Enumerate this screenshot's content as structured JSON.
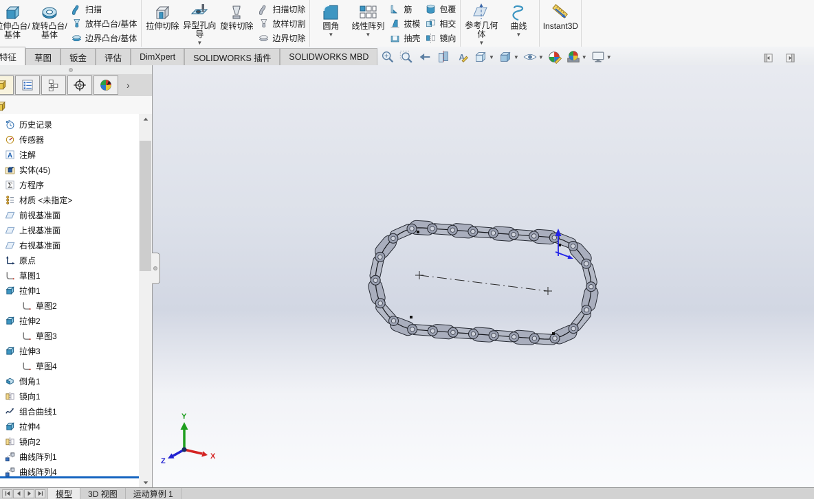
{
  "ribbon": {
    "groups": [
      {
        "name": "boss-base",
        "big": [
          {
            "label": "拉伸凸台/基体",
            "icon": "extrude-boss"
          },
          {
            "label": "旋转凸台/基体",
            "icon": "revolve-boss"
          }
        ],
        "small": [
          {
            "label": "扫描",
            "icon": "sweep"
          },
          {
            "label": "放样凸台/基体",
            "icon": "loft"
          },
          {
            "label": "边界凸台/基体",
            "icon": "boundary"
          }
        ]
      },
      {
        "name": "cut",
        "big": [
          {
            "label": "拉伸切除",
            "icon": "extrude-cut"
          },
          {
            "label": "异型孔向导",
            "icon": "hole-wizard",
            "dropdown": true
          },
          {
            "label": "旋转切除",
            "icon": "revolve-cut"
          }
        ],
        "small": [
          {
            "label": "扫描切除",
            "icon": "sweep-cut"
          },
          {
            "label": "放样切割",
            "icon": "loft-cut"
          },
          {
            "label": "边界切除",
            "icon": "boundary-cut"
          }
        ]
      },
      {
        "name": "pattern-features",
        "big": [
          {
            "label": "圆角",
            "icon": "fillet",
            "dropdown": true
          },
          {
            "label": "线性阵列",
            "icon": "linear-pattern",
            "dropdown": true
          }
        ],
        "small": [
          {
            "label": "筋",
            "icon": "rib"
          },
          {
            "label": "拔模",
            "icon": "draft"
          },
          {
            "label": "抽壳",
            "icon": "shell"
          }
        ],
        "small2": [
          {
            "label": "包覆",
            "icon": "wrap"
          },
          {
            "label": "相交",
            "icon": "intersect"
          },
          {
            "label": "镜向",
            "icon": "mirror-feature"
          }
        ]
      },
      {
        "name": "reference",
        "big": [
          {
            "label": "参考几何体",
            "icon": "reference-geometry",
            "dropdown": true
          },
          {
            "label": "曲线",
            "icon": "curves",
            "dropdown": true
          }
        ]
      },
      {
        "name": "instant3d",
        "big": [
          {
            "label": "Instant3D",
            "icon": "instant3d"
          }
        ]
      }
    ]
  },
  "command_tabs": [
    {
      "label": "特征",
      "active": true
    },
    {
      "label": "草图"
    },
    {
      "label": "钣金"
    },
    {
      "label": "评估"
    },
    {
      "label": "DimXpert"
    },
    {
      "label": "SOLIDWORKS 插件"
    },
    {
      "label": "SOLIDWORKS MBD"
    }
  ],
  "headsup": [
    {
      "name": "zoom-to-fit"
    },
    {
      "name": "zoom-to-area"
    },
    {
      "name": "previous-view"
    },
    {
      "name": "section-view"
    },
    {
      "name": "annotation-visibility"
    },
    {
      "name": "view-orientation",
      "dropdown": true
    },
    {
      "name": "display-style",
      "dropdown": true
    },
    {
      "name": "hide-show-items",
      "dropdown": true
    },
    {
      "name": "edit-appearance"
    },
    {
      "name": "apply-scene",
      "dropdown": true
    },
    {
      "name": "view-settings",
      "dropdown": true
    }
  ],
  "panel_toggles": [
    {
      "name": "collapse-left-pane"
    },
    {
      "name": "collapse-right-pane"
    }
  ],
  "feature_panel": {
    "tabs": [
      {
        "name": "featuremanager-design-tree",
        "active": true
      },
      {
        "name": "property-manager"
      },
      {
        "name": "configuration-manager"
      },
      {
        "name": "dimxpert-manager"
      },
      {
        "name": "display-manager"
      }
    ],
    "expand_chevron": "›",
    "tree": [
      {
        "label": "历史记录",
        "icon": "history"
      },
      {
        "label": "传感器",
        "icon": "sensors"
      },
      {
        "label": "注解",
        "icon": "annotations"
      },
      {
        "label": "实体(45)",
        "icon": "solid-bodies"
      },
      {
        "label": "方程序",
        "icon": "equations"
      },
      {
        "label": "材质 <未指定>",
        "icon": "material"
      },
      {
        "label": "前视基准面",
        "icon": "plane"
      },
      {
        "label": "上视基准面",
        "icon": "plane"
      },
      {
        "label": "右视基准面",
        "icon": "plane"
      },
      {
        "label": "原点",
        "icon": "origin"
      },
      {
        "label": "草图1",
        "icon": "sketch"
      },
      {
        "label": "拉伸1",
        "icon": "extrude"
      },
      {
        "label": "草图2",
        "icon": "sketch",
        "indent": 1
      },
      {
        "label": "拉伸2",
        "icon": "extrude"
      },
      {
        "label": "草图3",
        "icon": "sketch",
        "indent": 1
      },
      {
        "label": "拉伸3",
        "icon": "extrude"
      },
      {
        "label": "草图4",
        "icon": "sketch",
        "indent": 1
      },
      {
        "label": "倒角1",
        "icon": "chamfer"
      },
      {
        "label": "镜向1",
        "icon": "mirror"
      },
      {
        "label": "组合曲线1",
        "icon": "composite-curve"
      },
      {
        "label": "拉伸4",
        "icon": "extrude"
      },
      {
        "label": "镜向2",
        "icon": "mirror"
      },
      {
        "label": "曲线阵列1",
        "icon": "curve-pattern"
      },
      {
        "label": "曲线阵列4",
        "icon": "curve-pattern"
      }
    ]
  },
  "viewport": {
    "triad": {
      "x": "X",
      "y": "Y",
      "z": "Z"
    }
  },
  "bottom_bar": {
    "nav": [
      {
        "name": "first-tab"
      },
      {
        "name": "previous-tab"
      },
      {
        "name": "next-tab"
      },
      {
        "name": "last-tab"
      }
    ],
    "tabs": [
      {
        "label": "模型",
        "active": true
      },
      {
        "label": "3D 视图"
      },
      {
        "label": "运动算例 1"
      }
    ]
  },
  "colors": {
    "rollback_bar": "#1564c0",
    "viewport_top": "#e8eaf0",
    "viewport_mid": "#d2d7e3",
    "viewport_bottom": "#fafbfd",
    "triad_x": "#d42222",
    "triad_y": "#1e9e1e",
    "triad_z": "#2222d2",
    "chain_body": "#b0b5c3",
    "marker_blue": "#2424e8"
  }
}
